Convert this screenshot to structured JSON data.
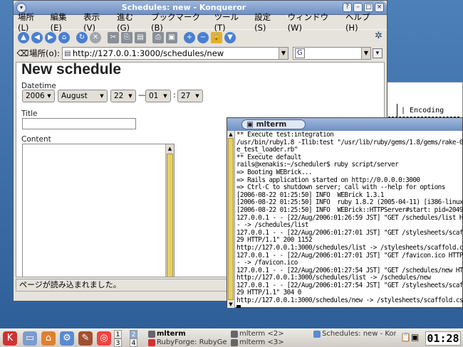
{
  "konqueror": {
    "title": "Schedules: new - Konqueror",
    "menu": [
      "場所(L)",
      "編集(E)",
      "表示(V)",
      "進む(G)",
      "ブックマーク(B)",
      "ツール(T)",
      "設定(S)",
      "ウィンドウ(W)",
      "ヘルプ(H)"
    ],
    "location_label": "場所(o):",
    "url": "http://127.0.0.1:3000/schedules/new",
    "search_icon_letter": "G",
    "status": "ページが読み込まれました。"
  },
  "form": {
    "page_title": "New schedule",
    "datetime_label": "Datetime",
    "year": "2006",
    "month": "August",
    "day": "22",
    "hour": "01",
    "minute": "27",
    "date_time_sep": "—",
    "time_sep": ":",
    "title_label": "Title",
    "content_label": "Content"
  },
  "bg_window": {
    "text": "| Encoding"
  },
  "mlterm": {
    "title": "mlterm",
    "lines": [
      "** Execute test:integration",
      "/usr/bin/ruby1.8 -Ilib:test \"/usr/lib/ruby/gems/1.8/gems/rake-0",
      "e_test_loader.rb\"",
      "** Execute default",
      "rails@xenakis:~/scheduler$ ruby script/server",
      "=> Booting WEBrick...",
      "=> Rails application started on http://0.0.0.0:3000",
      "=> Ctrl-C to shutdown server; call with --help for options",
      "[2006-08-22 01:25:50] INFO  WEBrick 1.3.1",
      "[2006-08-22 01:25:50] INFO  ruby 1.8.2 (2005-04-11) [i386-linux",
      "[2006-08-22 01:25:50] INFO  WEBrick::HTTPServer#start: pid=2049",
      "127.0.0.1 - - [22/Aug/2006:01:26:59 JST] \"GET /schedules/list H",
      "- -> /schedules/list",
      "127.0.0.1 - - [22/Aug/2006:01:27:01 JST] \"GET /stylesheets/scaff",
      "29 HTTP/1.1\" 200 1152",
      "http://127.0.0.1:3000/schedules/list -> /stylesheets/scaffold.c",
      "127.0.0.1 - - [22/Aug/2006:01:27:01 JST] \"GET /favicon.ico HTTP",
      "- -> /favicon.ico",
      "127.0.0.1 - - [22/Aug/2006:01:27:54 JST] \"GET /schedules/new HTT",
      "http://127.0.0.1:3000/schedules/list -> /schedules/new",
      "127.0.0.1 - - [22/Aug/2006:01:27:54 JST] \"GET /stylesheets/scaff",
      "29 HTTP/1.1\" 304 0",
      "http://127.0.0.1:3000/schedules/new -> /stylesheets/scaffold.cs"
    ]
  },
  "taskbar": {
    "pager": [
      "1",
      "2",
      "3",
      "4"
    ],
    "tasks_row1": [
      "mlterm",
      "mlterm <2>",
      "Schedules: new - Kor"
    ],
    "tasks_row2": [
      "RubyForge: RubyGen",
      "mlterm <3>"
    ],
    "clock": "01:28"
  },
  "colors": {
    "accent": "#6f8fc4",
    "scroll_thumb": "#e4d068",
    "desktop": "#3d6fa8"
  }
}
